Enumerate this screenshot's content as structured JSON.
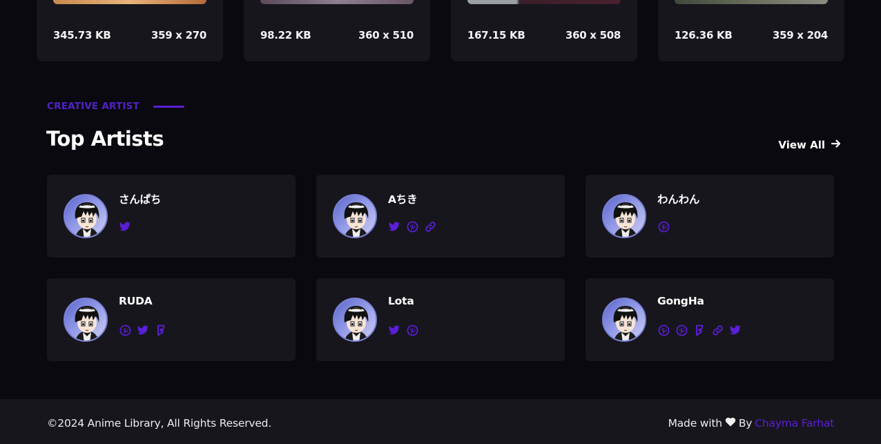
{
  "images": [
    {
      "size": "345.73 KB",
      "dims": "359 x 270"
    },
    {
      "size": "98.22 KB",
      "dims": "360 x 510"
    },
    {
      "size": "167.15 KB",
      "dims": "360 x 508"
    },
    {
      "size": "126.36 KB",
      "dims": "359 x 204"
    }
  ],
  "section": {
    "eyebrow": "CREATIVE ARTIST",
    "title": "Top Artists",
    "view_all": "View All"
  },
  "artists": [
    {
      "name": "さんぱち",
      "socials": [
        "twitter-icon"
      ]
    },
    {
      "name": "Aちき",
      "socials": [
        "twitter-icon",
        "pinterest-icon",
        "link-icon"
      ]
    },
    {
      "name": "わんわん",
      "socials": [
        "pinterest-icon"
      ]
    },
    {
      "name": "RUDA",
      "socials": [
        "pinterest-icon",
        "twitter-icon",
        "foursquare-icon"
      ]
    },
    {
      "name": "Lota",
      "socials": [
        "twitter-icon",
        "pinterest-icon"
      ]
    },
    {
      "name": "GongHa",
      "socials": [
        "pinterest-icon",
        "pinterest-icon",
        "foursquare-icon",
        "link-icon",
        "twitter-icon"
      ]
    }
  ],
  "footer": {
    "copyright": "©2024 Anime Library, All Rights Reserved.",
    "made_with": "Made with",
    "by": "By",
    "author": "Chayma Farhat"
  },
  "colors": {
    "accent": "#5a1fd8",
    "card": "#17161d",
    "background": "#0a090f"
  }
}
